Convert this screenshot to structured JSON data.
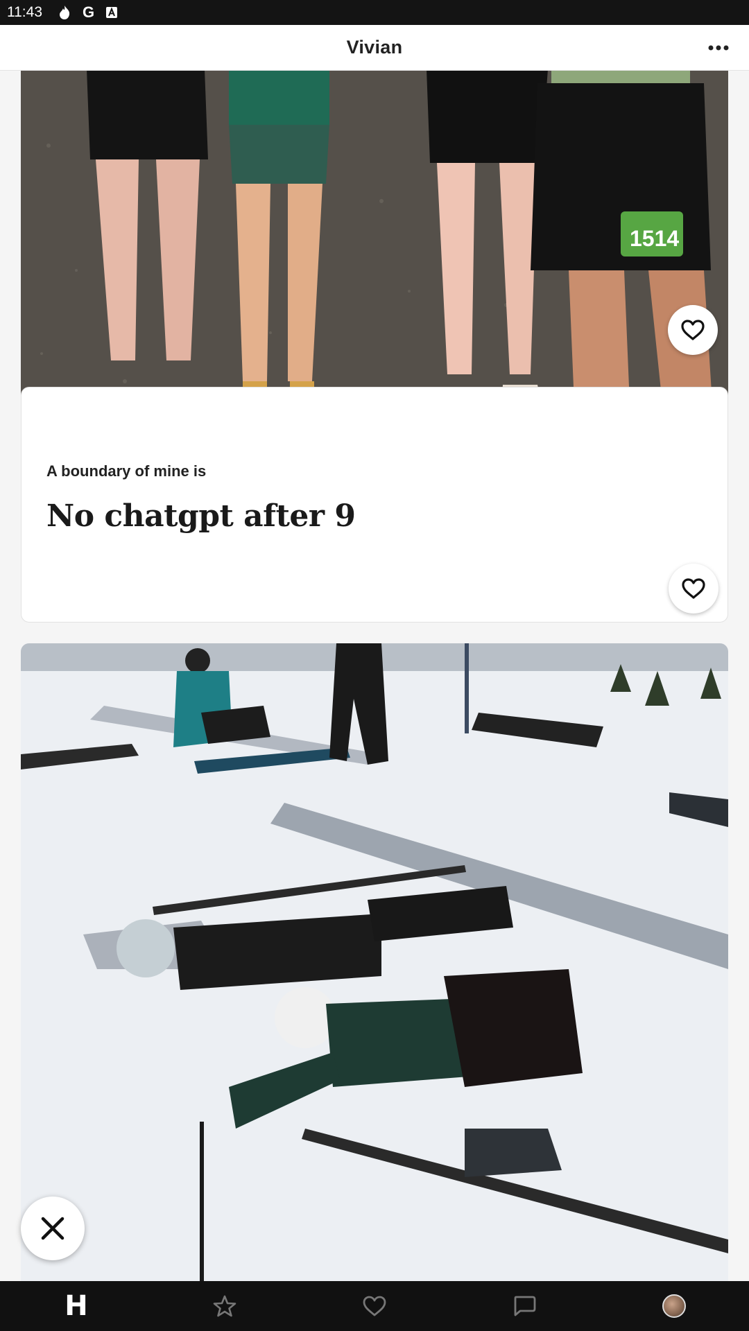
{
  "status_bar": {
    "time": "11:43",
    "icons": [
      "flame-icon",
      "google-icon",
      "a-badge-icon"
    ],
    "google_glyph": "G"
  },
  "header": {
    "title": "Vivian",
    "more_icon": "more-horizontal-icon"
  },
  "profile": {
    "photos": [
      {
        "subject": "Legs of four people standing on gravel, one wearing race bib 1514",
        "bib_text": "1514"
      },
      {
        "subject": "Two skiers lying in the snow on a ski slope with snowboards around"
      }
    ],
    "prompt": {
      "question": "A boundary of mine is",
      "answer": "No chatgpt after 9"
    }
  },
  "actions": {
    "like_icon": "heart-icon",
    "skip_icon": "close-icon"
  },
  "bottom_nav": {
    "items": [
      {
        "name": "discover",
        "icon": "hinge-logo-icon",
        "glyph": "H",
        "active": true
      },
      {
        "name": "standouts",
        "icon": "star-icon",
        "active": false
      },
      {
        "name": "likes-you",
        "icon": "heart-icon",
        "active": false
      },
      {
        "name": "matches",
        "icon": "chat-icon",
        "active": false
      },
      {
        "name": "profile",
        "icon": "avatar",
        "active": false
      }
    ]
  },
  "colors": {
    "status_bar_bg": "#141414",
    "nav_bg": "#111111",
    "card_bg": "#ffffff",
    "page_bg": "#f5f5f5"
  }
}
